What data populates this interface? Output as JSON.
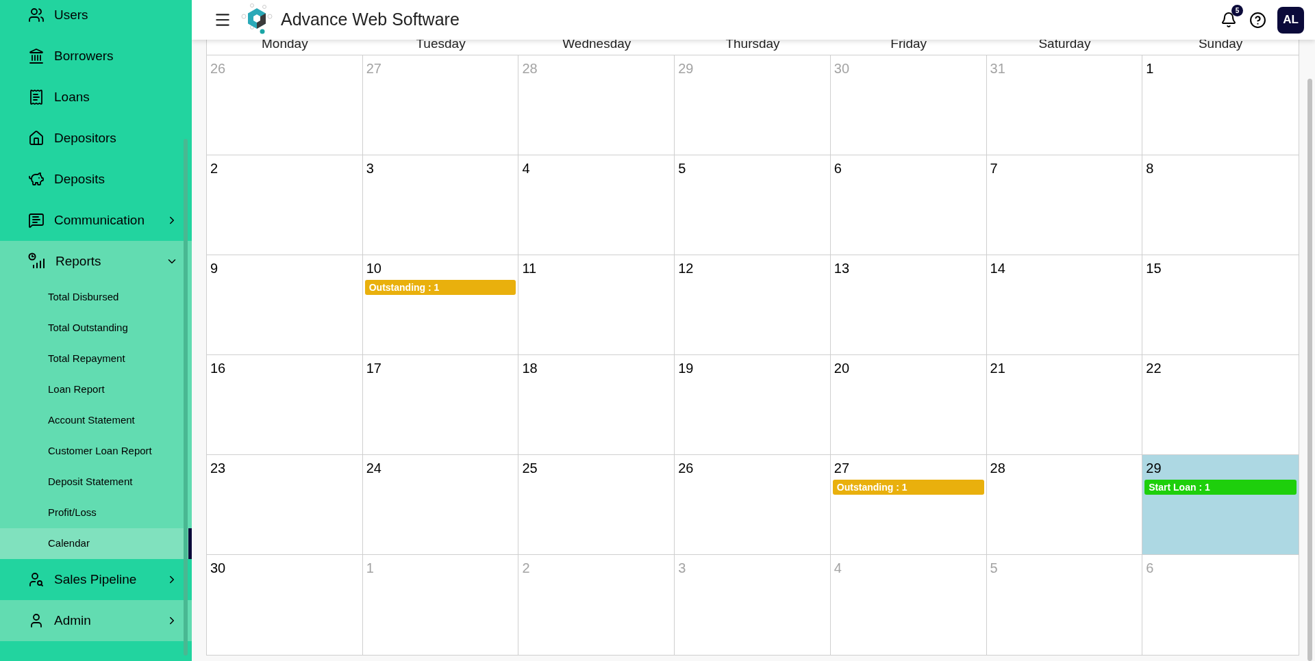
{
  "sidebar": {
    "items": [
      {
        "label": "Users",
        "kind": "item"
      },
      {
        "label": "Borrowers",
        "kind": "item"
      },
      {
        "label": "Loans",
        "kind": "item"
      },
      {
        "label": "Depositors",
        "kind": "item"
      },
      {
        "label": "Deposits",
        "kind": "item"
      },
      {
        "label": "Communication",
        "kind": "group",
        "expanded": false,
        "hovered": false
      },
      {
        "label": "Reports",
        "kind": "group",
        "expanded": true,
        "hovered": false,
        "children": [
          {
            "label": "Total Disbursed",
            "selected": false
          },
          {
            "label": "Total Outstanding",
            "selected": false
          },
          {
            "label": "Total Repayment",
            "selected": false
          },
          {
            "label": "Loan Report",
            "selected": false
          },
          {
            "label": "Account Statement",
            "selected": false
          },
          {
            "label": "Customer Loan Report",
            "selected": false
          },
          {
            "label": "Deposit Statement",
            "selected": false
          },
          {
            "label": "Profit/Loss",
            "selected": false
          },
          {
            "label": "Calendar",
            "selected": true
          }
        ]
      },
      {
        "label": "Sales Pipeline",
        "kind": "group",
        "expanded": false,
        "hovered": false
      },
      {
        "label": "Admin",
        "kind": "group",
        "expanded": false,
        "hovered": true
      }
    ]
  },
  "header": {
    "title": "Advance Web Software",
    "notifications": "5",
    "avatar": "AL"
  },
  "calendar": {
    "weekdays": [
      "Monday",
      "Tuesday",
      "Wednesday",
      "Thursday",
      "Friday",
      "Saturday",
      "Sunday"
    ],
    "weeks": [
      [
        {
          "day": "26",
          "muted": true,
          "today": false
        },
        {
          "day": "27",
          "muted": true,
          "today": false
        },
        {
          "day": "28",
          "muted": true,
          "today": false
        },
        {
          "day": "29",
          "muted": true,
          "today": false
        },
        {
          "day": "30",
          "muted": true,
          "today": false
        },
        {
          "day": "31",
          "muted": true,
          "today": false
        },
        {
          "day": "1",
          "muted": false,
          "today": false
        }
      ],
      [
        {
          "day": "2",
          "muted": false,
          "today": false
        },
        {
          "day": "3",
          "muted": false,
          "today": false
        },
        {
          "day": "4",
          "muted": false,
          "today": false
        },
        {
          "day": "5",
          "muted": false,
          "today": false
        },
        {
          "day": "6",
          "muted": false,
          "today": false
        },
        {
          "day": "7",
          "muted": false,
          "today": false
        },
        {
          "day": "8",
          "muted": false,
          "today": false
        }
      ],
      [
        {
          "day": "9",
          "muted": false,
          "today": false
        },
        {
          "day": "10",
          "muted": false,
          "today": false,
          "events": [
            {
              "label": "Outstanding : 1",
              "color": "#e9b00d"
            }
          ]
        },
        {
          "day": "11",
          "muted": false,
          "today": false
        },
        {
          "day": "12",
          "muted": false,
          "today": false
        },
        {
          "day": "13",
          "muted": false,
          "today": false
        },
        {
          "day": "14",
          "muted": false,
          "today": false
        },
        {
          "day": "15",
          "muted": false,
          "today": false
        }
      ],
      [
        {
          "day": "16",
          "muted": false,
          "today": false
        },
        {
          "day": "17",
          "muted": false,
          "today": false
        },
        {
          "day": "18",
          "muted": false,
          "today": false
        },
        {
          "day": "19",
          "muted": false,
          "today": false
        },
        {
          "day": "20",
          "muted": false,
          "today": false
        },
        {
          "day": "21",
          "muted": false,
          "today": false
        },
        {
          "day": "22",
          "muted": false,
          "today": false
        }
      ],
      [
        {
          "day": "23",
          "muted": false,
          "today": false
        },
        {
          "day": "24",
          "muted": false,
          "today": false
        },
        {
          "day": "25",
          "muted": false,
          "today": false
        },
        {
          "day": "26",
          "muted": false,
          "today": false
        },
        {
          "day": "27",
          "muted": false,
          "today": false,
          "events": [
            {
              "label": "Outstanding : 1",
              "color": "#e9b00d"
            }
          ]
        },
        {
          "day": "28",
          "muted": false,
          "today": false
        },
        {
          "day": "29",
          "muted": false,
          "today": true,
          "events": [
            {
              "label": "Start Loan : 1",
              "color": "#1ecf0c"
            }
          ]
        }
      ],
      [
        {
          "day": "30",
          "muted": false,
          "today": false
        },
        {
          "day": "1",
          "muted": true,
          "today": false
        },
        {
          "day": "2",
          "muted": true,
          "today": false
        },
        {
          "day": "3",
          "muted": true,
          "today": false
        },
        {
          "day": "4",
          "muted": true,
          "today": false
        },
        {
          "day": "5",
          "muted": true,
          "today": false
        },
        {
          "day": "6",
          "muted": true,
          "today": false
        }
      ]
    ]
  }
}
